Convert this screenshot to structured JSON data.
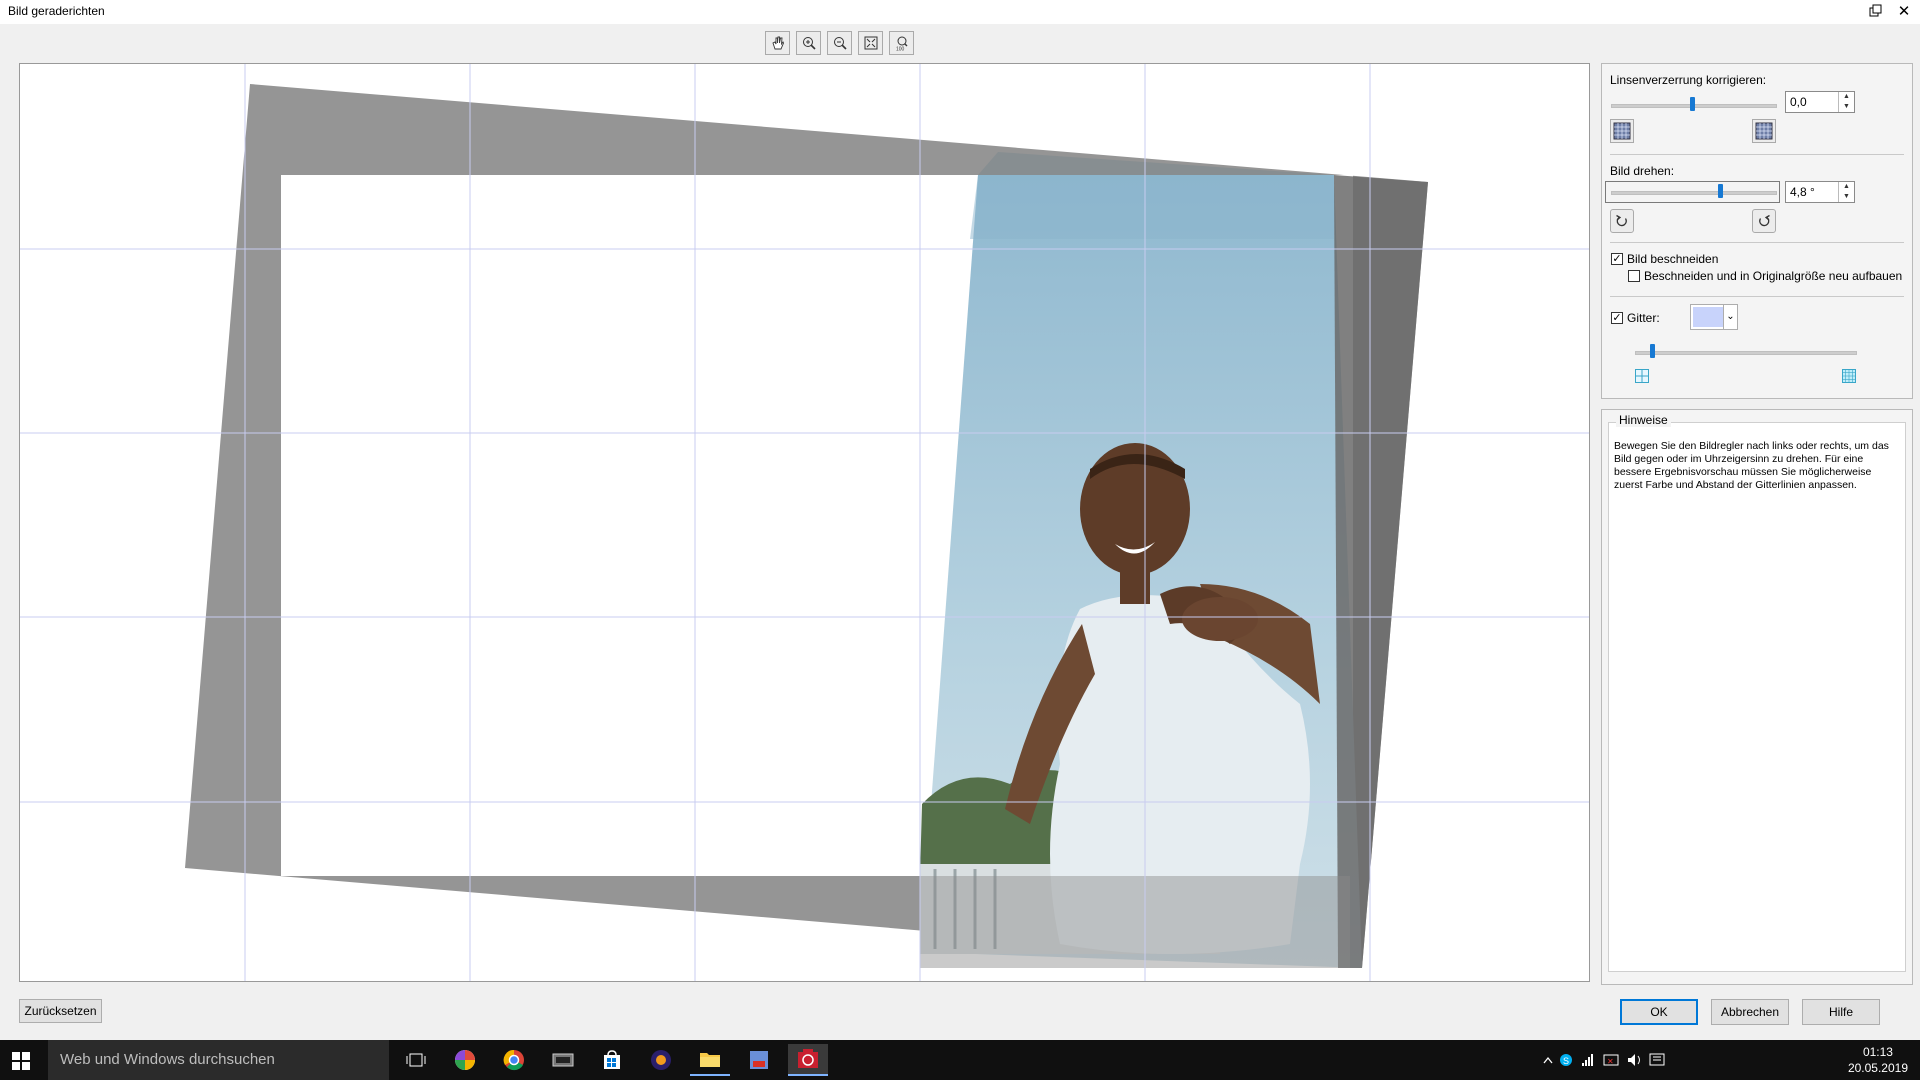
{
  "window": {
    "title": "Bild geraderichten"
  },
  "toolbar": {
    "tools": [
      "hand-tool",
      "zoom-in",
      "zoom-out",
      "fit-to-window",
      "zoom-100"
    ]
  },
  "panel": {
    "lens_label": "Linsenverzerrung korrigieren:",
    "lens_value": "0,0",
    "lens_slider_level": 0.5,
    "rotate_label": "Bild drehen:",
    "rotate_value": "4,8 °",
    "rotate_slider_level": 0.63,
    "crop_label": "Bild beschneiden",
    "crop_checked": true,
    "crop_rebuild_label": "Beschneiden und in Originalgröße neu aufbauen",
    "crop_rebuild_checked": false,
    "grid_label": "Gitter:",
    "grid_checked": true,
    "grid_color": "#c8d3fb",
    "grid_slider_level": 0.08
  },
  "hints": {
    "caption": "Hinweise",
    "text": "Bewegen Sie den Bildregler nach links oder rechts, um das Bild gegen oder im Uhrzeigersinn zu drehen. Für eine bessere Ergebnisvorschau müssen Sie möglicherweise zuerst Farbe und Abstand der Gitterlinien anpassen."
  },
  "buttons": {
    "reset": "Zurücksetzen",
    "ok": "OK",
    "cancel": "Abbrechen",
    "help": "Hilfe"
  },
  "taskbar": {
    "search_placeholder": "Web und Windows durchsuchen",
    "time": "01:13",
    "date": "20.05.2019"
  },
  "colors": {
    "grid_line": "#c8ccf0",
    "preview_gray": "#959595",
    "sky": "#a7c9da",
    "taskbar": "#101010"
  }
}
